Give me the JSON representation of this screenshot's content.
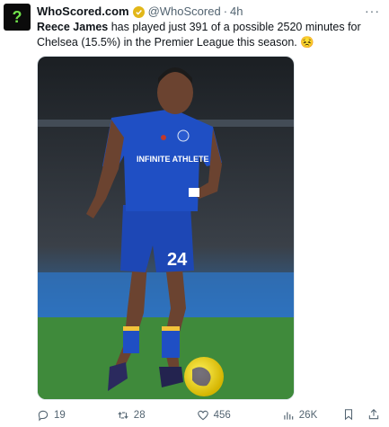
{
  "tweet": {
    "display_name": "WhoScored.com",
    "handle": "@WhoScored",
    "separator": "·",
    "time": "4h",
    "more_label": "···",
    "text_name": "Reece James",
    "text_body": " has played just 391 of a possible 2520 minutes for Chelsea (15.5%) in the Premier League this season.",
    "emoji": "😣",
    "avatar_glyph": "?"
  },
  "media": {
    "sponsor_text": "INFINITE ATHLETE",
    "shirt_number": "24"
  },
  "actions": {
    "replies": "19",
    "reposts": "28",
    "likes": "456",
    "views": "26K"
  },
  "icons": [
    "reply-icon",
    "repost-icon",
    "like-icon",
    "views-icon",
    "bookmark-icon",
    "share-icon",
    "verified-icon",
    "more-icon"
  ],
  "colors": {
    "text": "#0f1419",
    "secondary": "#536471",
    "verified_gold": "#e2b719",
    "chelsea_blue": "#1f4fc4",
    "pitch_green": "#3d8a3a"
  }
}
